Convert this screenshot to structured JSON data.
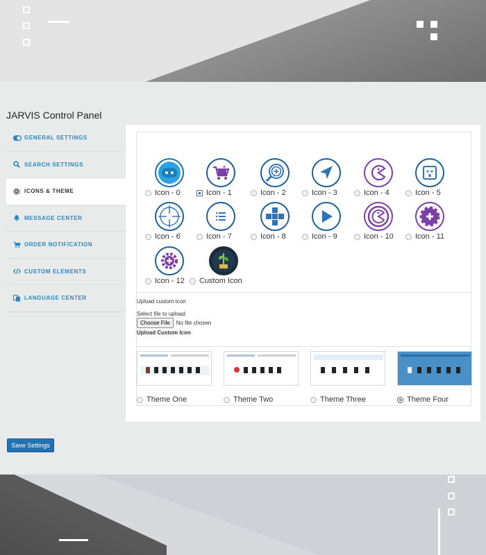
{
  "panel": {
    "title": "JARVIS Control Panel"
  },
  "sidebar": {
    "items": [
      {
        "label": "GENERAL SETTINGS",
        "icon": "toggle-icon"
      },
      {
        "label": "SEARCH SETTINGS",
        "icon": "search-icon"
      },
      {
        "label": "ICONS & THEME",
        "icon": "gear-icon"
      },
      {
        "label": "MESSAGE CENTER",
        "icon": "bell-icon"
      },
      {
        "label": "ORDER NOTIFICATION",
        "icon": "cart-icon"
      },
      {
        "label": "CUSTOM ELEMENTS",
        "icon": "code-icon"
      },
      {
        "label": "LANGUAGE CENTER",
        "icon": "language-icon"
      }
    ]
  },
  "icons": {
    "selected": "Icon - 1",
    "items": [
      {
        "label": "Icon - 0"
      },
      {
        "label": "Icon - 1"
      },
      {
        "label": "Icon - 2"
      },
      {
        "label": "Icon - 3"
      },
      {
        "label": "Icon - 4"
      },
      {
        "label": "Icon - 5"
      },
      {
        "label": "Icon - 6"
      },
      {
        "label": "Icon - 7"
      },
      {
        "label": "Icon - 8"
      },
      {
        "label": "Icon - 9"
      },
      {
        "label": "Icon - 10"
      },
      {
        "label": "Icon - 11"
      },
      {
        "label": "Icon - 12"
      },
      {
        "label": "Custom Icon"
      }
    ]
  },
  "upload": {
    "heading": "Upload custom Icon",
    "select_label": "Select file to upload",
    "choose_button": "Choose File",
    "file_status": "No file chosen",
    "upload_label": "Upload Custom Icon"
  },
  "themes": {
    "selected": "Theme Four",
    "items": [
      {
        "label": "Theme One"
      },
      {
        "label": "Theme Two"
      },
      {
        "label": "Theme Three"
      },
      {
        "label": "Theme Four"
      }
    ]
  },
  "actions": {
    "save_label": "Save Settings"
  },
  "colors": {
    "accent": "#2271b1",
    "icon_purple": "#7b3fa6",
    "icon_blue": "#2e73b8"
  }
}
